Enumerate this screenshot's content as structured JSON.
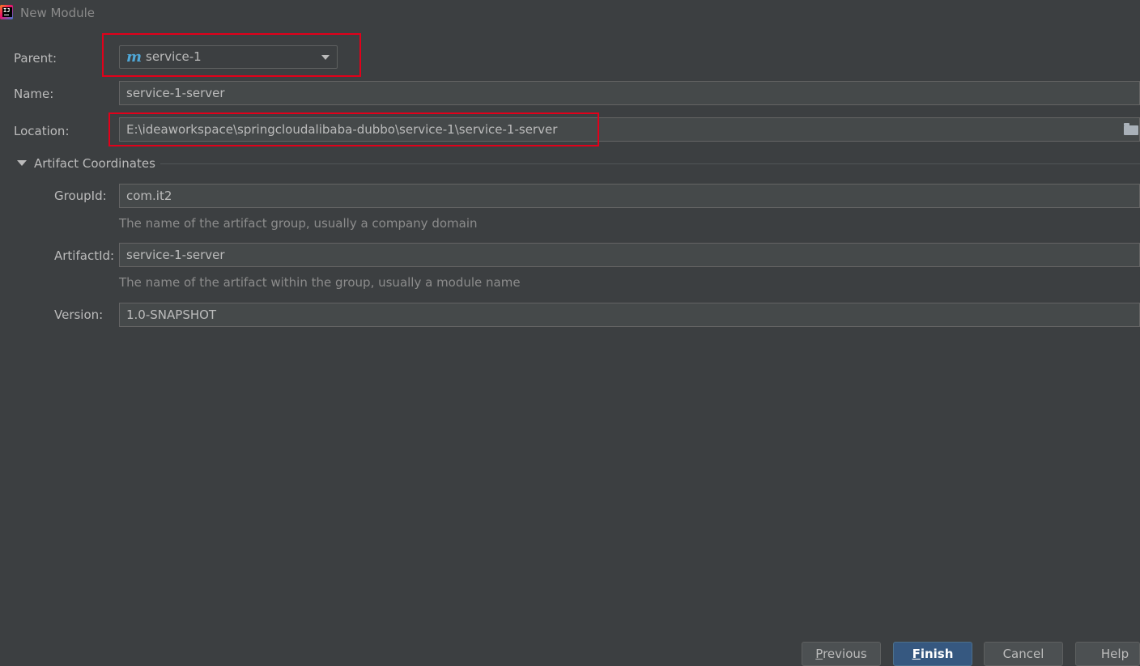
{
  "window": {
    "title": "New Module"
  },
  "form": {
    "parent": {
      "label": "Parent:",
      "value": "service-1",
      "icon": "maven-module-icon"
    },
    "name": {
      "label": "Name:",
      "value": "service-1-server"
    },
    "location": {
      "label": "Location:",
      "value": "E:\\ideaworkspace\\springcloudalibaba-dubbo\\service-1\\service-1-server",
      "icon": "folder-icon"
    }
  },
  "artifact": {
    "section_title": "Artifact Coordinates",
    "group_id": {
      "label": "GroupId:",
      "value": "com.it2",
      "hint": "The name of the artifact group, usually a company domain"
    },
    "artifact_id": {
      "label": "ArtifactId:",
      "value": "service-1-server",
      "hint": "The name of the artifact within the group, usually a module name"
    },
    "version": {
      "label": "Version:",
      "value": "1.0-SNAPSHOT"
    }
  },
  "buttons": {
    "previous": {
      "mnemonic": "P",
      "rest": "revious"
    },
    "finish": {
      "mnemonic": "F",
      "rest": "inish"
    },
    "cancel": "Cancel",
    "help": "Help"
  },
  "colors": {
    "background": "#3c3f41",
    "field_background": "#45494a",
    "highlight": "#e2001a",
    "primary_button": "#365880",
    "maven_icon": "#4fa8d8"
  }
}
